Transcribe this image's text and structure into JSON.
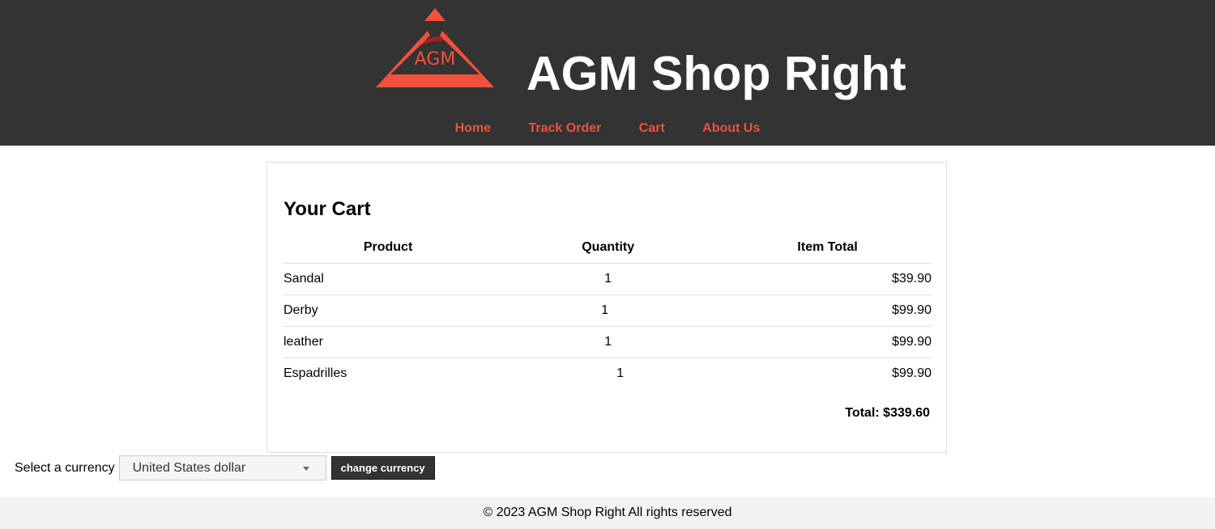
{
  "header": {
    "logo_text": "AGM",
    "site_title": "AGM Shop Right",
    "brand_color": "#f0503c",
    "background_color": "#333333"
  },
  "nav": {
    "items": [
      {
        "label": "Home"
      },
      {
        "label": "Track Order"
      },
      {
        "label": "Cart"
      },
      {
        "label": "About Us"
      }
    ]
  },
  "cart": {
    "title": "Your Cart",
    "columns": [
      "Product",
      "Quantity",
      "Item Total"
    ],
    "rows": [
      {
        "product": "Sandal",
        "quantity": "1",
        "total": "$39.90"
      },
      {
        "product": "Derby",
        "quantity": "1",
        "total": "$99.90"
      },
      {
        "product": "leather",
        "quantity": "1",
        "total": "$99.90"
      },
      {
        "product": "Espadrilles",
        "quantity": "1",
        "total": "$99.90"
      }
    ],
    "total_label": "Total: $339.60"
  },
  "currency": {
    "label": "Select a currency",
    "selected": "United States dollar",
    "button_label": "change currency"
  },
  "footer": {
    "text": "© 2023 AGM Shop Right All rights reserved"
  }
}
